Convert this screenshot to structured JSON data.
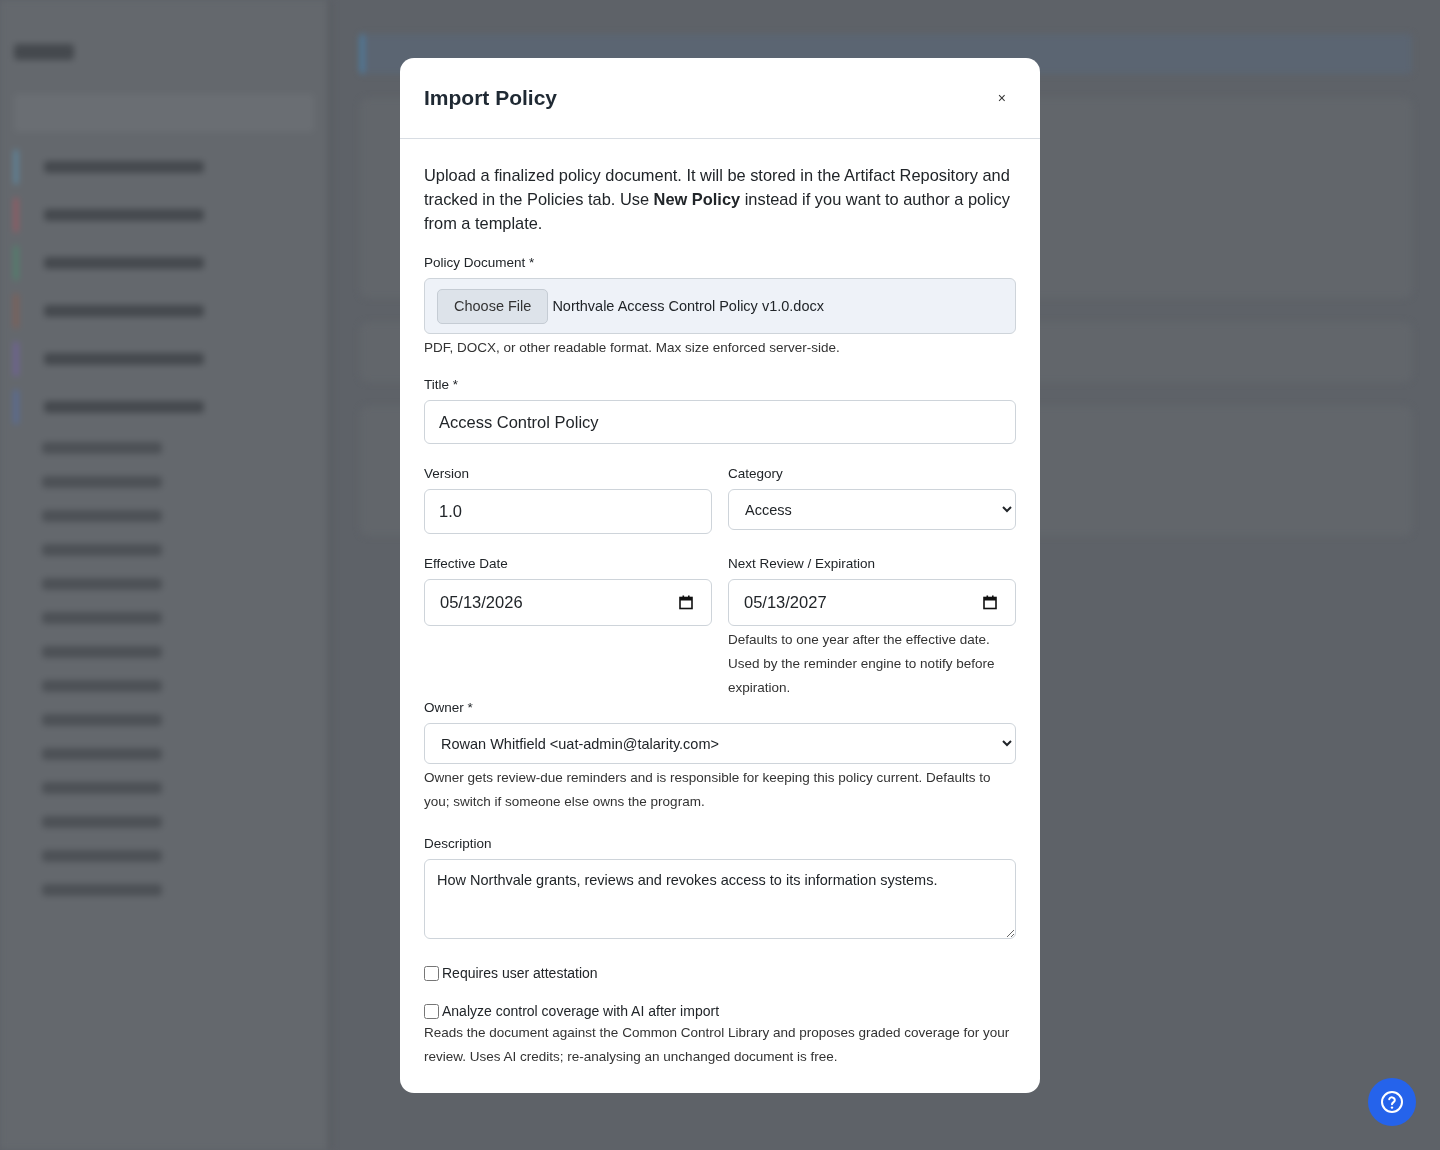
{
  "modal": {
    "title": "Import Policy",
    "close": "×",
    "intro": "Upload a finalized policy document. It will be stored in the Artifact Repository and tracked in the Policies tab. Use **New Policy** instead if you want to author a policy from a template.",
    "policy_document": {
      "label": "Policy Document *",
      "button": "Choose File",
      "value": "Northvale Access Control Policy v1.0.docx",
      "help": "PDF, DOCX, or other readable format. Max size enforced server-side."
    },
    "title_field": {
      "label": "Title *",
      "value": "Access Control Policy"
    },
    "version": {
      "label": "Version",
      "value": "1.0"
    },
    "category": {
      "label": "Category",
      "value": "Access"
    },
    "effective_date": {
      "label": "Effective Date",
      "value": "05/13/2026"
    },
    "next_review": {
      "label": "Next Review / Expiration",
      "value": "05/13/2027",
      "help": "Defaults to one year after the effective date. Used by the reminder engine to notify before expiration."
    },
    "owner": {
      "label": "Owner *",
      "value": "Rowan Whitfield <uat-admin@talarity.com>",
      "help": "Owner gets review-due reminders and is responsible for keeping this policy current. Defaults to you; switch if someone else owns the program."
    },
    "description": {
      "label": "Description",
      "value": "How Northvale grants, reviews and revokes access to its information systems."
    },
    "checkboxes": [
      {
        "label": "Requires user attestation",
        "checked": false
      },
      {
        "label": "Analyze control coverage with AI after import",
        "checked": false,
        "help": "Reads the document against the Common Control Library and proposes graded coverage for your review. Uses AI credits; re-analysing an unchanged document is free."
      }
    ]
  }
}
